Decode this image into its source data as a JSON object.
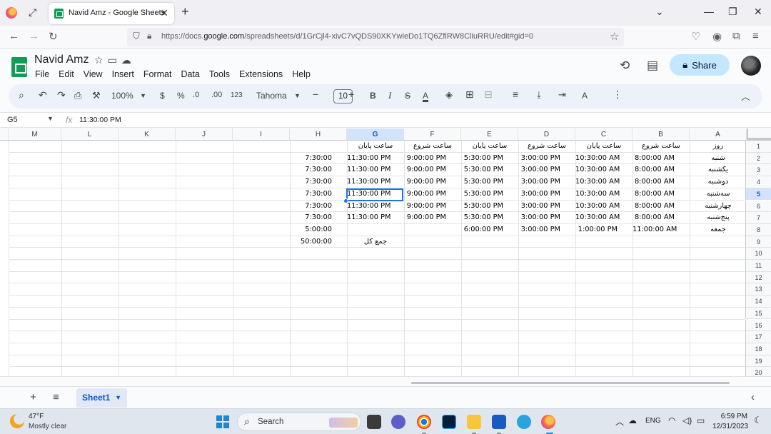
{
  "browser": {
    "tab_title": "Navid Amz - Google Sheets",
    "url_prefix": "https://docs.",
    "url_domain": "google.com",
    "url_rest": "/spreadsheets/d/1GrCjl4-xivC7vQDS90XKYwieDo1TQ6ZfiRW8CliuRRU/edit#gid=0"
  },
  "sheets": {
    "doc_title": "Navid Amz",
    "menu": [
      "File",
      "Edit",
      "View",
      "Insert",
      "Format",
      "Data",
      "Tools",
      "Extensions",
      "Help"
    ],
    "share_label": "Share",
    "toolbar": {
      "zoom": "100%",
      "currency": "$",
      "percent": "%",
      "dec_dec": ".0",
      "dec_inc": ".00",
      "format_123": "123",
      "font": "Tahoma",
      "font_size": "10"
    },
    "formula_bar": {
      "cell_ref": "G5",
      "value": "11:30:00 PM"
    },
    "columns": [
      "M",
      "L",
      "K",
      "J",
      "I",
      "H",
      "G",
      "F",
      "E",
      "D",
      "C",
      "B",
      "A"
    ],
    "selected_column": "G",
    "row_numbers": [
      "1",
      "2",
      "3",
      "4",
      "5",
      "6",
      "7",
      "8",
      "9",
      "10",
      "11",
      "12",
      "13",
      "14",
      "15",
      "16",
      "17",
      "18",
      "19",
      "20"
    ],
    "selected_row": "5",
    "rows": [
      {
        "A": "روز",
        "B": "ساعت شروع",
        "C": "ساعت پایان",
        "D": "ساعت شروع",
        "E": "ساعت پایان",
        "F": "ساعت شروع",
        "G": "ساعت پایان",
        "H": ""
      },
      {
        "A": "شنبه",
        "B": "8:00:00 AM",
        "C": "10:30:00 AM",
        "D": "3:00:00 PM",
        "E": "5:30:00 PM",
        "F": "9:00:00 PM",
        "G": "11:30:00 PM",
        "H": "7:30:00"
      },
      {
        "A": "یکشنبه",
        "B": "8:00:00 AM",
        "C": "10:30:00 AM",
        "D": "3:00:00 PM",
        "E": "5:30:00 PM",
        "F": "9:00:00 PM",
        "G": "11:30:00 PM",
        "H": "7:30:00"
      },
      {
        "A": "دوشنبه",
        "B": "8:00:00 AM",
        "C": "10:30:00 AM",
        "D": "3:00:00 PM",
        "E": "5:30:00 PM",
        "F": "9:00:00 PM",
        "G": "11:30:00 PM",
        "H": "7:30:00"
      },
      {
        "A": "سه‌شنبه",
        "B": "8:00:00 AM",
        "C": "10:30:00 AM",
        "D": "3:00:00 PM",
        "E": "5:30:00 PM",
        "F": "9:00:00 PM",
        "G": "11:30:00 PM",
        "H": "7:30:00"
      },
      {
        "A": "چهارشنبه",
        "B": "8:00:00 AM",
        "C": "10:30:00 AM",
        "D": "3:00:00 PM",
        "E": "5:30:00 PM",
        "F": "9:00:00 PM",
        "G": "11:30:00 PM",
        "H": "7:30:00"
      },
      {
        "A": "پنج‌شنبه",
        "B": "8:00:00 AM",
        "C": "10:30:00 AM",
        "D": "3:00:00 PM",
        "E": "5:30:00 PM",
        "F": "9:00:00 PM",
        "G": "11:30:00 PM",
        "H": "7:30:00"
      },
      {
        "A": "جمعه",
        "B": "11:00:00 AM",
        "C": "1:00:00 PM",
        "D": "3:00:00 PM",
        "E": "6:00:00 PM",
        "F": "",
        "G": "",
        "H": "5:00:00"
      },
      {
        "A": "",
        "B": "",
        "C": "",
        "D": "",
        "E": "",
        "F": "",
        "G": "جمع کل",
        "H": "50:00:00"
      }
    ],
    "sheet_tab": "Sheet1"
  },
  "taskbar": {
    "temperature": "47°F",
    "weather": "Mostly clear",
    "search_label": "Search",
    "language": "ENG",
    "time": "6:59 PM",
    "date": "12/31/2023"
  }
}
